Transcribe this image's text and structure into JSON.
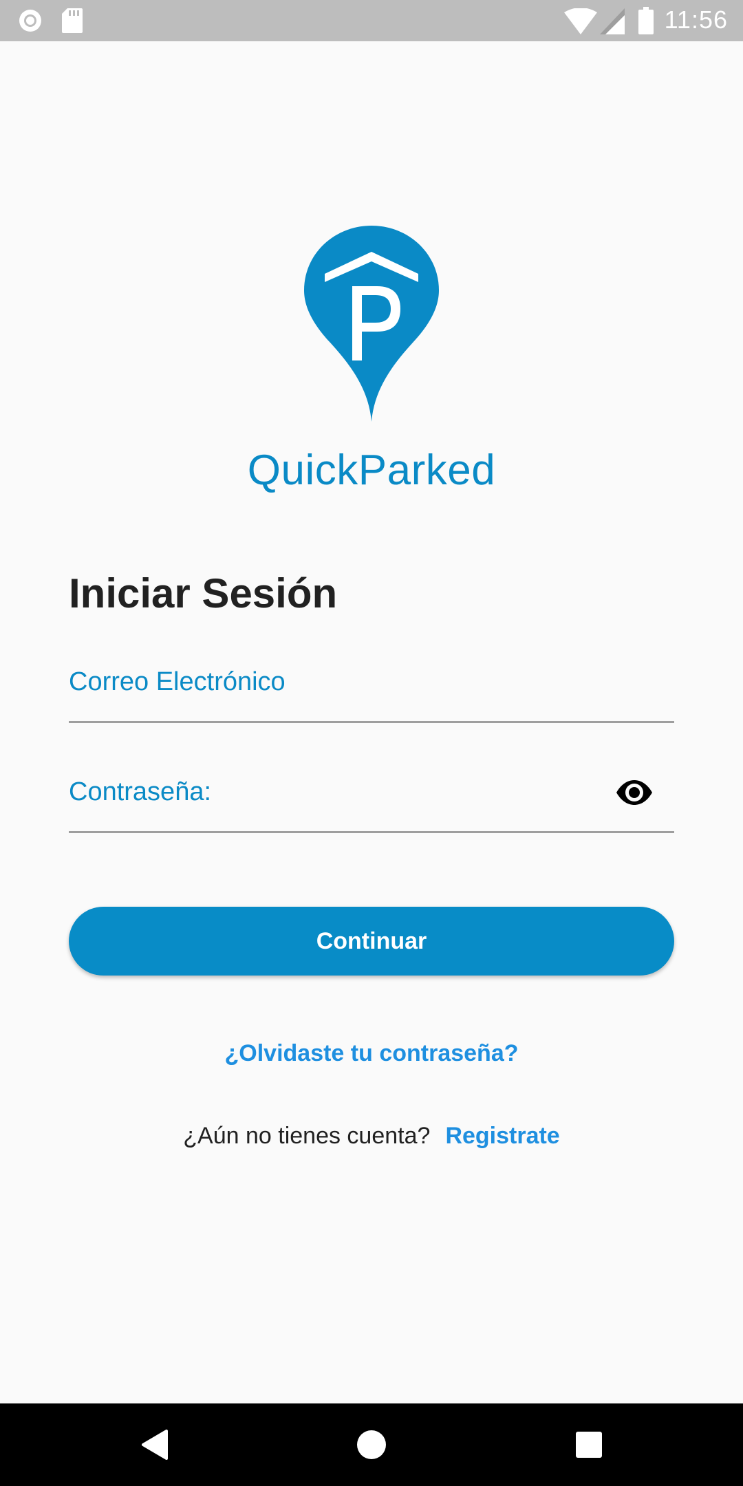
{
  "status_bar": {
    "time": "11:56",
    "icons": [
      "record-icon",
      "sd-card-icon",
      "wifi-icon",
      "signal-icon",
      "battery-icon"
    ]
  },
  "app": {
    "name": "QuickParked",
    "logo": "parking-pin-logo",
    "brand_color": "#0a8ac6"
  },
  "login": {
    "title": "Iniciar Sesión",
    "email_label": "Correo Electrónico",
    "email_value": "",
    "password_label": "Contraseña:",
    "password_value": "",
    "continue_label": "Continuar",
    "forgot_password": "¿Olvidaste tu contraseña?",
    "no_account": "¿Aún no tienes cuenta?",
    "register": "Registrate"
  },
  "nav_bar": {
    "buttons": [
      "back-icon",
      "home-icon",
      "recents-icon"
    ]
  }
}
